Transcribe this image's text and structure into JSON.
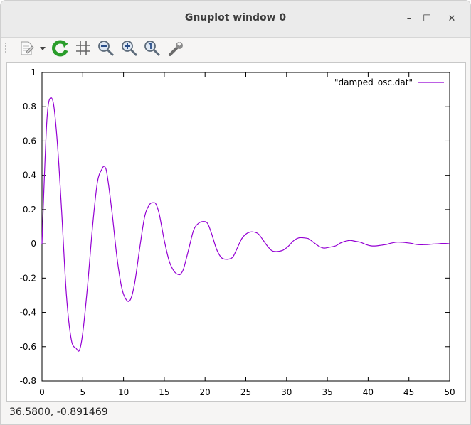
{
  "window": {
    "title": "Gnuplot window 0",
    "controls": {
      "minimize": "–",
      "maximize": "☐",
      "close": "✕"
    }
  },
  "toolbar": {
    "items": [
      {
        "icon": "export-icon"
      },
      {
        "icon": "dropdown-arrow-icon"
      },
      {
        "icon": "replot-icon"
      },
      {
        "icon": "grid-icon"
      },
      {
        "icon": "zoom-out-icon"
      },
      {
        "icon": "zoom-in-icon"
      },
      {
        "icon": "zoom-reset-icon"
      },
      {
        "icon": "settings-wrench-icon"
      }
    ]
  },
  "statusbar": {
    "coords": "36.5800, -0.891469"
  },
  "colors": {
    "series": "#9400d3",
    "toolbar_green": "#2a9d2a"
  },
  "chart_data": {
    "type": "line",
    "title": "",
    "xlabel": "",
    "ylabel": "",
    "xlim": [
      0,
      50
    ],
    "ylim": [
      -0.8,
      1
    ],
    "x_ticks": [
      "0",
      "5",
      "10",
      "15",
      "20",
      "25",
      "30",
      "35",
      "40",
      "45",
      "50"
    ],
    "y_ticks": [
      "-0.8",
      "-0.6",
      "-0.4",
      "-0.2",
      "0",
      "0.2",
      "0.4",
      "0.6",
      "0.8",
      "1"
    ],
    "legend_position": "top-right",
    "grid": false,
    "series": [
      {
        "name": "\"damped_osc.dat\"",
        "x": [
          0,
          0.3,
          0.6,
          0.9,
          1.4,
          1.9,
          2.4,
          3.0,
          3.6,
          4.2,
          4.6,
          5.0,
          5.6,
          6.2,
          6.8,
          7.4,
          7.7,
          8.0,
          8.6,
          9.2,
          9.8,
          10.4,
          10.9,
          11.4,
          12.0,
          12.6,
          13.2,
          13.7,
          14.0,
          14.4,
          15.0,
          15.6,
          16.2,
          16.8,
          17.1,
          17.4,
          18.0,
          18.6,
          19.2,
          19.8,
          20.3,
          20.8,
          21.4,
          22.0,
          22.6,
          23.2,
          23.5,
          23.9,
          24.5,
          25.1,
          25.7,
          26.3,
          26.6,
          27.0,
          27.6,
          28.2,
          28.8,
          29.4,
          29.8,
          30.3,
          30.9,
          31.5,
          32.1,
          32.7,
          33.0,
          33.4,
          34.0,
          34.6,
          35.2,
          35.8,
          36.1,
          36.6,
          37.2,
          37.8,
          38.4,
          39.0,
          39.3,
          39.8,
          40.4,
          41.0,
          41.6,
          42.2,
          42.5,
          43.0,
          43.6,
          44.2,
          44.8,
          45.4,
          45.7,
          46.2,
          46.8,
          47.4,
          48.0,
          48.6,
          49.0,
          49.5,
          50.0
        ],
        "y": [
          0.0,
          0.4,
          0.72,
          0.84,
          0.82,
          0.58,
          0.2,
          -0.3,
          -0.56,
          -0.61,
          -0.62,
          -0.52,
          -0.24,
          0.1,
          0.36,
          0.44,
          0.45,
          0.4,
          0.18,
          -0.08,
          -0.26,
          -0.33,
          -0.32,
          -0.22,
          -0.02,
          0.16,
          0.23,
          0.24,
          0.23,
          0.17,
          0.02,
          -0.1,
          -0.16,
          -0.18,
          -0.17,
          -0.14,
          -0.03,
          0.08,
          0.12,
          0.13,
          0.12,
          0.06,
          -0.03,
          -0.08,
          -0.09,
          -0.085,
          -0.07,
          -0.03,
          0.03,
          0.06,
          0.07,
          0.065,
          0.055,
          0.03,
          -0.01,
          -0.04,
          -0.045,
          -0.04,
          -0.03,
          -0.01,
          0.02,
          0.035,
          0.035,
          0.03,
          0.02,
          0.005,
          -0.015,
          -0.025,
          -0.02,
          -0.015,
          -0.01,
          0.005,
          0.015,
          0.02,
          0.015,
          0.01,
          0.005,
          -0.005,
          -0.012,
          -0.012,
          -0.008,
          -0.004,
          0.0,
          0.006,
          0.01,
          0.009,
          0.006,
          0.002,
          -0.002,
          -0.005,
          -0.005,
          -0.004,
          -0.001,
          0.0,
          0.002,
          0.002,
          0.0
        ]
      }
    ]
  }
}
